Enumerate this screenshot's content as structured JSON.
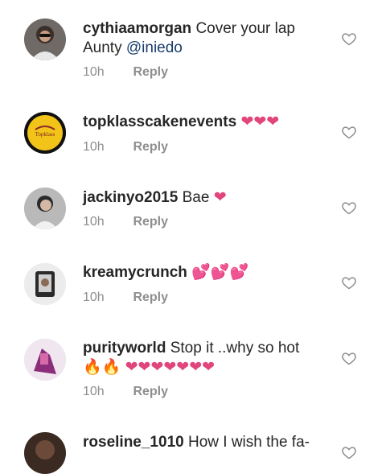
{
  "comments": [
    {
      "username": "cythiaamorgan",
      "text": "Cover your lap",
      "text2": "Aunty",
      "mention": "@iniedo",
      "time": "10h",
      "reply": "Reply",
      "emoji": ""
    },
    {
      "username": "topklasscakenevents",
      "text": "",
      "emoji": "❤❤❤",
      "time": "10h",
      "reply": "Reply",
      "avatar_text": "Topklass"
    },
    {
      "username": "jackinyo2015",
      "text": "Bae",
      "emoji": "❤",
      "time": "10h",
      "reply": "Reply"
    },
    {
      "username": "kreamycrunch",
      "text": "",
      "emoji": "💕💕💕",
      "time": "10h",
      "reply": "Reply"
    },
    {
      "username": "purityworld",
      "text": "Stop it ..why so hot",
      "emoji_fire": "🔥🔥",
      "emoji": "❤❤❤❤❤❤❤",
      "time": "10h",
      "reply": "Reply"
    },
    {
      "username": "roseline_1010",
      "text": "How I wish the fa-"
    }
  ],
  "colors": {
    "heart": "#e0457b",
    "meta": "#8e8e8e",
    "mention": "#1a3d6e"
  }
}
